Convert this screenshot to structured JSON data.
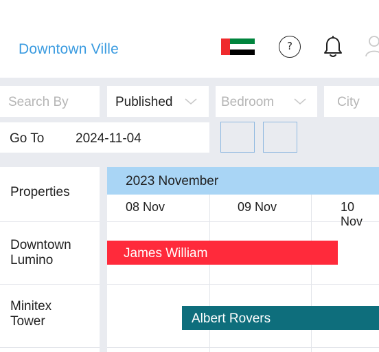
{
  "app": {
    "title": "Downtown Ville"
  },
  "header": {
    "flag_icon": "uae-flag-icon",
    "help_icon": "help-icon",
    "help_glyph": "?",
    "bell_icon": "bell-icon",
    "user_icon": "user-icon"
  },
  "filters": {
    "search_by": {
      "placeholder": "Search By"
    },
    "status": {
      "value": "Published"
    },
    "bedroom": {
      "placeholder": "Bedroom"
    },
    "city": {
      "placeholder": "City"
    }
  },
  "goto": {
    "label": "Go To",
    "date": "2024-11-04"
  },
  "calendar": {
    "month": "2023 November",
    "days": [
      "08 Nov",
      "09 Nov",
      "10 Nov"
    ],
    "properties_header": "Properties",
    "rows": [
      {
        "name_line1": "Downtown",
        "name_line2": "Lumino"
      },
      {
        "name_line1": "Minitex",
        "name_line2": "Tower"
      }
    ],
    "bookings": [
      {
        "guest": "James William",
        "color": "#ff2a3b"
      },
      {
        "guest": "Albert Rovers",
        "color": "#0e6e7c"
      }
    ]
  },
  "colors": {
    "accent": "#3a9be0",
    "month_band": "#a9d5f5"
  }
}
